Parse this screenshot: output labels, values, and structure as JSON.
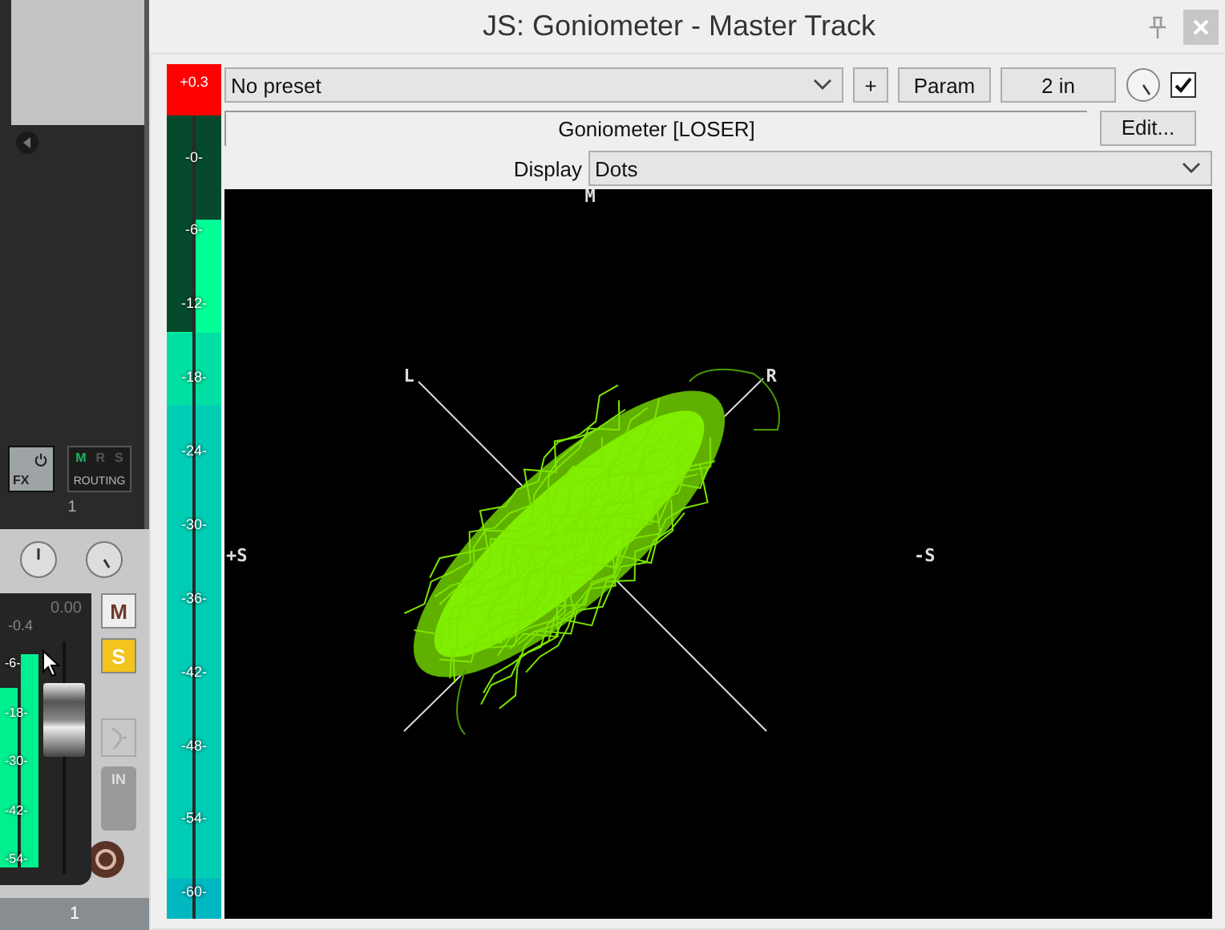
{
  "mixer": {
    "fx_label": "FX",
    "routing_letters": [
      {
        "label": "M",
        "on": true
      },
      {
        "label": "R",
        "on": false
      },
      {
        "label": "S",
        "on": false
      }
    ],
    "routing_label": "ROUTING",
    "track_number": "1",
    "volume": "0.00",
    "peak": "-0.4",
    "meter_ticks": [
      "-6-",
      "-18-",
      "-30-",
      "-42-",
      "-54-"
    ],
    "mute": {
      "label": "M",
      "on": false
    },
    "solo": {
      "label": "S",
      "on": true
    },
    "input_label": "IN",
    "footer_number": "1"
  },
  "window": {
    "title": "JS: Goniometer - Master Track"
  },
  "meter": {
    "peak_reading": "+0.3",
    "ticks": [
      "-0-",
      "-6-",
      "-12-",
      "-18-",
      "-24-",
      "-30-",
      "-36-",
      "-42-",
      "-48-",
      "-54-",
      "-60-"
    ]
  },
  "preset": {
    "value": "No preset"
  },
  "add_button": "+",
  "param_button": "Param",
  "io_button": "2 in",
  "enabled": {
    "checked": true
  },
  "plugin_name": "Goniometer [LOSER]",
  "edit_button": "Edit...",
  "display": {
    "label": "Display",
    "value": "Dots"
  },
  "scope": {
    "labels": [
      {
        "text": "M",
        "kind": "top"
      },
      {
        "text": "L",
        "kind": "left"
      },
      {
        "text": "R",
        "kind": "right"
      },
      {
        "text": "+S",
        "kind": "side-plus"
      },
      {
        "text": "-S",
        "kind": "side-minus"
      }
    ]
  }
}
